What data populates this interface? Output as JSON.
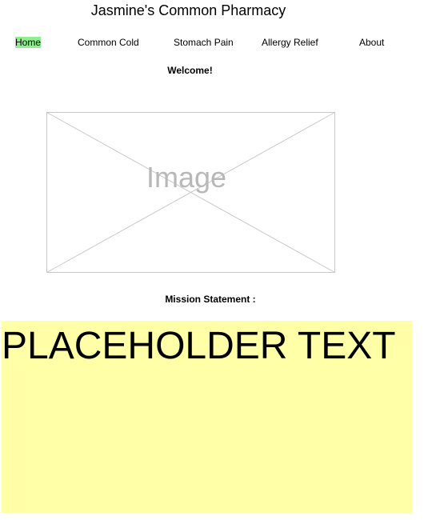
{
  "site": {
    "title": "Jasmine's Common Pharmacy"
  },
  "nav": {
    "items": [
      {
        "label": "Home",
        "active": true
      },
      {
        "label": "Common Cold",
        "active": false
      },
      {
        "label": "Stomach Pain",
        "active": false
      },
      {
        "label": "Allergy Relief",
        "active": false
      },
      {
        "label": "About",
        "active": false
      }
    ],
    "active_highlight_color": "#90ee90"
  },
  "main": {
    "welcome": "Welcome!",
    "image_placeholder_label": "Image",
    "mission_label": "Mission Statement :",
    "mission_text": "PLACEHOLDER TEXT",
    "mission_background": "#ffffa8"
  }
}
